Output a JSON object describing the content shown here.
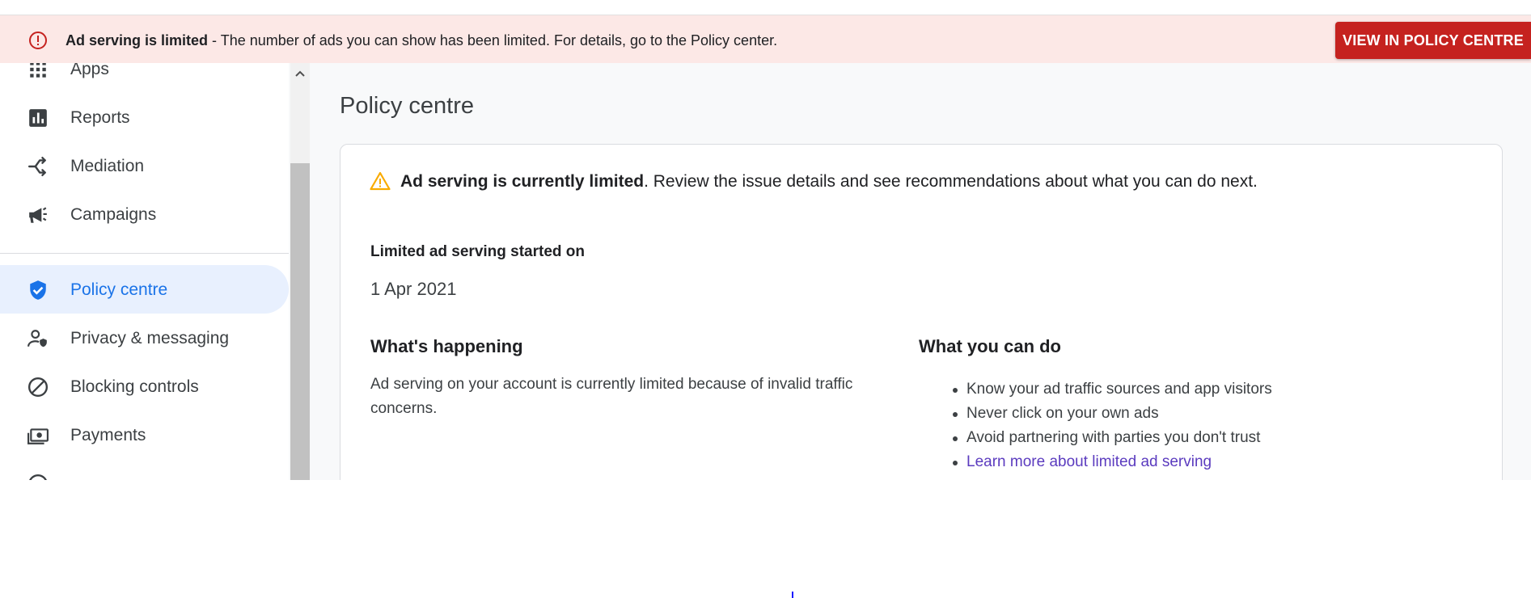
{
  "banner": {
    "title": "Ad serving is limited",
    "message": " - The number of ads you can show has been limited. For details, go to the Policy center.",
    "button_label": "VIEW IN POLICY CENTRE",
    "icon": "error-circle-icon",
    "bg_color": "#fce8e6",
    "button_color": "#c5221f"
  },
  "sidebar": {
    "items": [
      {
        "label": "Apps",
        "icon": "apps-grid-icon"
      },
      {
        "label": "Reports",
        "icon": "bar-chart-icon"
      },
      {
        "label": "Mediation",
        "icon": "mediation-fork-icon"
      },
      {
        "label": "Campaigns",
        "icon": "megaphone-icon"
      },
      {
        "label": "Policy centre",
        "icon": "shield-check-icon",
        "active": true
      },
      {
        "label": "Privacy & messaging",
        "icon": "person-shield-icon"
      },
      {
        "label": "Blocking controls",
        "icon": "block-icon"
      },
      {
        "label": "Payments",
        "icon": "payments-icon"
      }
    ],
    "active_color": "#1a73e8"
  },
  "main": {
    "page_title": "Policy centre",
    "card": {
      "warning_bold": "Ad serving is currently limited",
      "warning_rest": ". Review the issue details and see recommendations about what you can do next.",
      "started_label": "Limited ad serving started on",
      "started_value": "1 Apr 2021",
      "happening_heading": "What's happening",
      "happening_text": "Ad serving on your account is currently limited because of invalid traffic concerns.",
      "cando_heading": "What you can do",
      "cando_items": [
        "Know your ad traffic sources and app visitors",
        "Never click on your own ads",
        "Avoid partnering with parties you don't trust"
      ],
      "learn_more_link": "Learn more about limited ad serving",
      "warning_color": "#f9ab00",
      "link_color": "#5b3bbf"
    }
  }
}
